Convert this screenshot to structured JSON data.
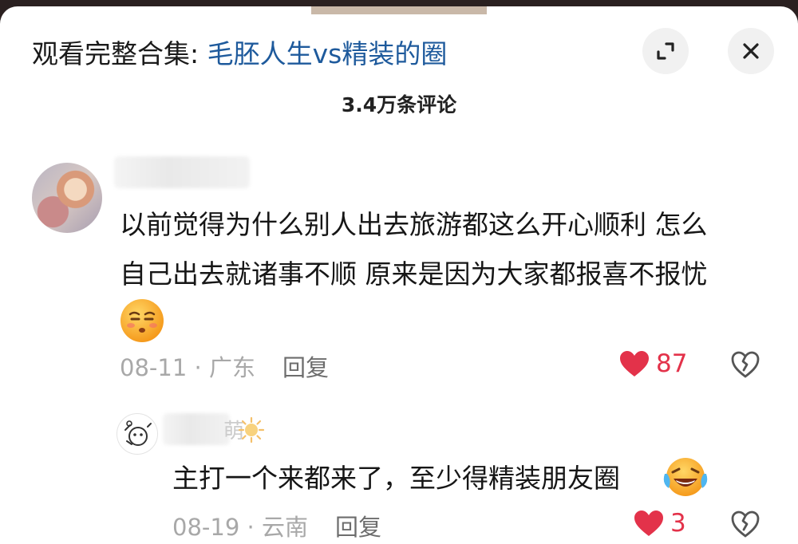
{
  "header": {
    "prefix": "观看完整合集: ",
    "collection_title": "毛胚人生vs精装的圈",
    "expand_icon": "expand-icon",
    "close_icon": "close-icon"
  },
  "comment_count": "3.4万条评论",
  "comments": [
    {
      "line1": "以前觉得为什么别人出去旅游都这么开心顺利 怎么",
      "line2": "自己出去就诸事不顺 原来是因为大家都报喜不报忧",
      "emoji": "smug-face-emoji",
      "date": "08-11",
      "location": "广东",
      "reply_label": "回复",
      "likes": "87"
    }
  ],
  "reply": {
    "name_suffix": "萌",
    "name_emoji": "sun-emoji",
    "text": "主打一个来都来了，至少得精装朋友圈",
    "emoji": "laughing-crying-emoji",
    "date": "08-19",
    "location": "云南",
    "reply_label": "回复",
    "likes": "3"
  },
  "colors": {
    "link": "#1e5a9c",
    "like": "#e3324a",
    "meta": "#a8a8a8"
  }
}
